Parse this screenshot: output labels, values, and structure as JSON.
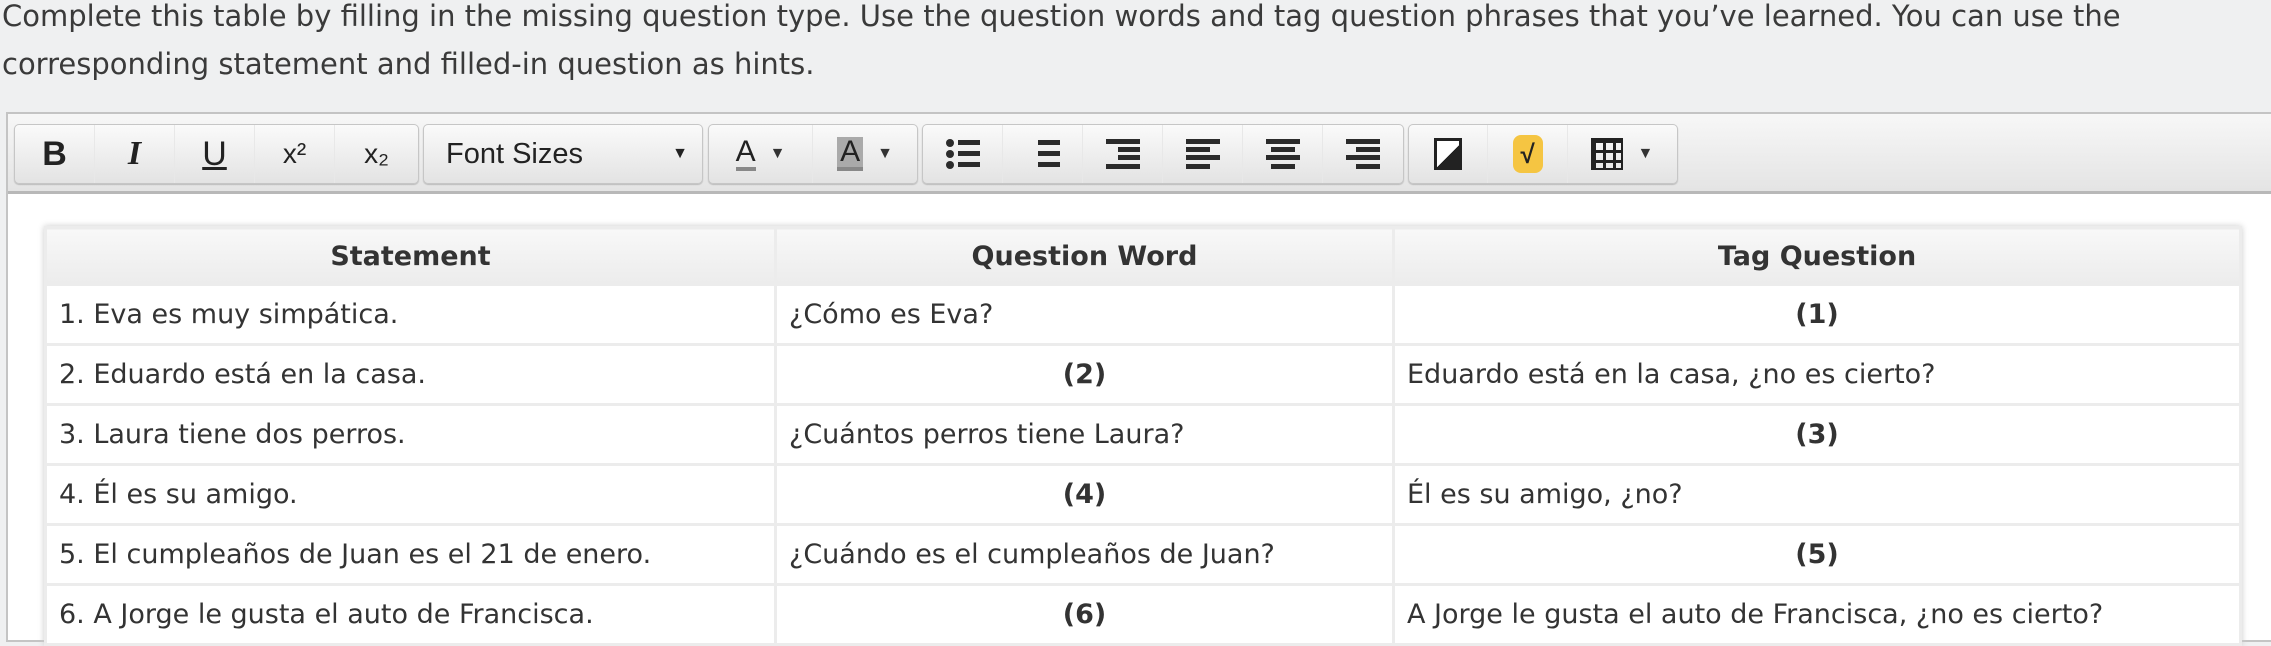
{
  "prompt": "Complete this table by filling in the missing question type. Use the question words and tag question phrases that you’ve learned. You can use the corresponding statement and filled-in question as hints.",
  "toolbar": {
    "bold": "B",
    "italic": "I",
    "underline": "U",
    "superscript": "x²",
    "subscript": "x₂",
    "font_sizes": "Font Sizes",
    "font_color": "A",
    "bg_color": "A"
  },
  "table": {
    "headers": [
      "Statement",
      "Question Word",
      "Tag Question"
    ],
    "rows": [
      [
        "1. Eva es muy simpática.",
        "¿Cómo es Eva?",
        "(1)"
      ],
      [
        "2. Eduardo está en la casa.",
        "(2)",
        "Eduardo está en la casa, ¿no es cierto?"
      ],
      [
        "3. Laura tiene dos perros.",
        "¿Cuántos perros tiene Laura?",
        "(3)"
      ],
      [
        "4. Él es su amigo.",
        "(4)",
        "Él es su amigo, ¿no?"
      ],
      [
        "5. El cumpleaños de Juan es el 21 de enero.",
        "¿Cuándo es el  cumpleaños de Juan?",
        "(5)"
      ],
      [
        "6. A Jorge le gusta el auto de Francisca.",
        "(6)",
        "A Jorge le gusta el auto de Francisca, ¿no es cierto?"
      ]
    ]
  }
}
